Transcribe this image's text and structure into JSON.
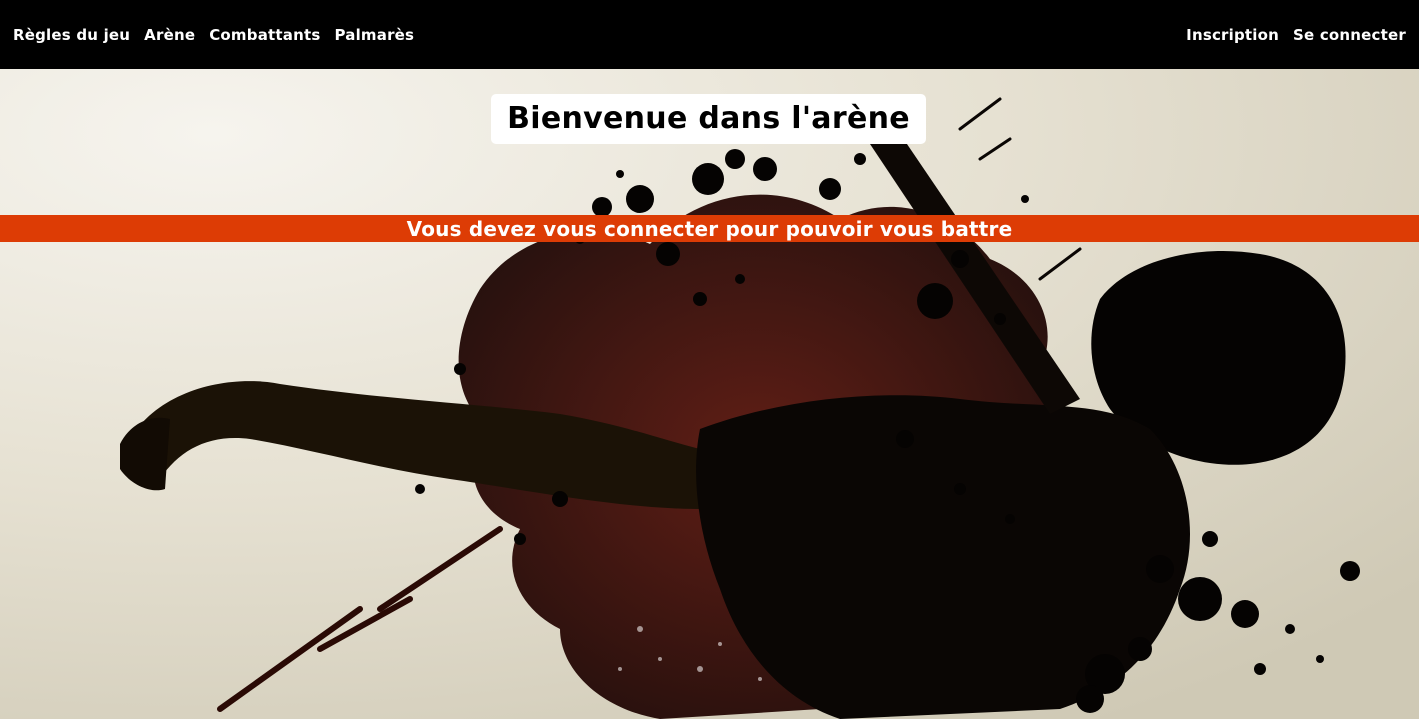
{
  "nav": {
    "left": [
      {
        "label": "Règles du jeu"
      },
      {
        "label": "Arène"
      },
      {
        "label": "Combattants"
      },
      {
        "label": "Palmarès"
      }
    ],
    "right": [
      {
        "label": "Inscription"
      },
      {
        "label": "Se connecter"
      }
    ]
  },
  "hero": {
    "title": "Bienvenue dans l'arène",
    "alert": "Vous devez vous connecter pour pouvoir vous battre",
    "background_image": "ink-splatter-fighter-silhouette"
  },
  "colors": {
    "navbar_bg": "#000000",
    "alert_bg": "#dd3c05",
    "title_bg": "#ffffff"
  }
}
